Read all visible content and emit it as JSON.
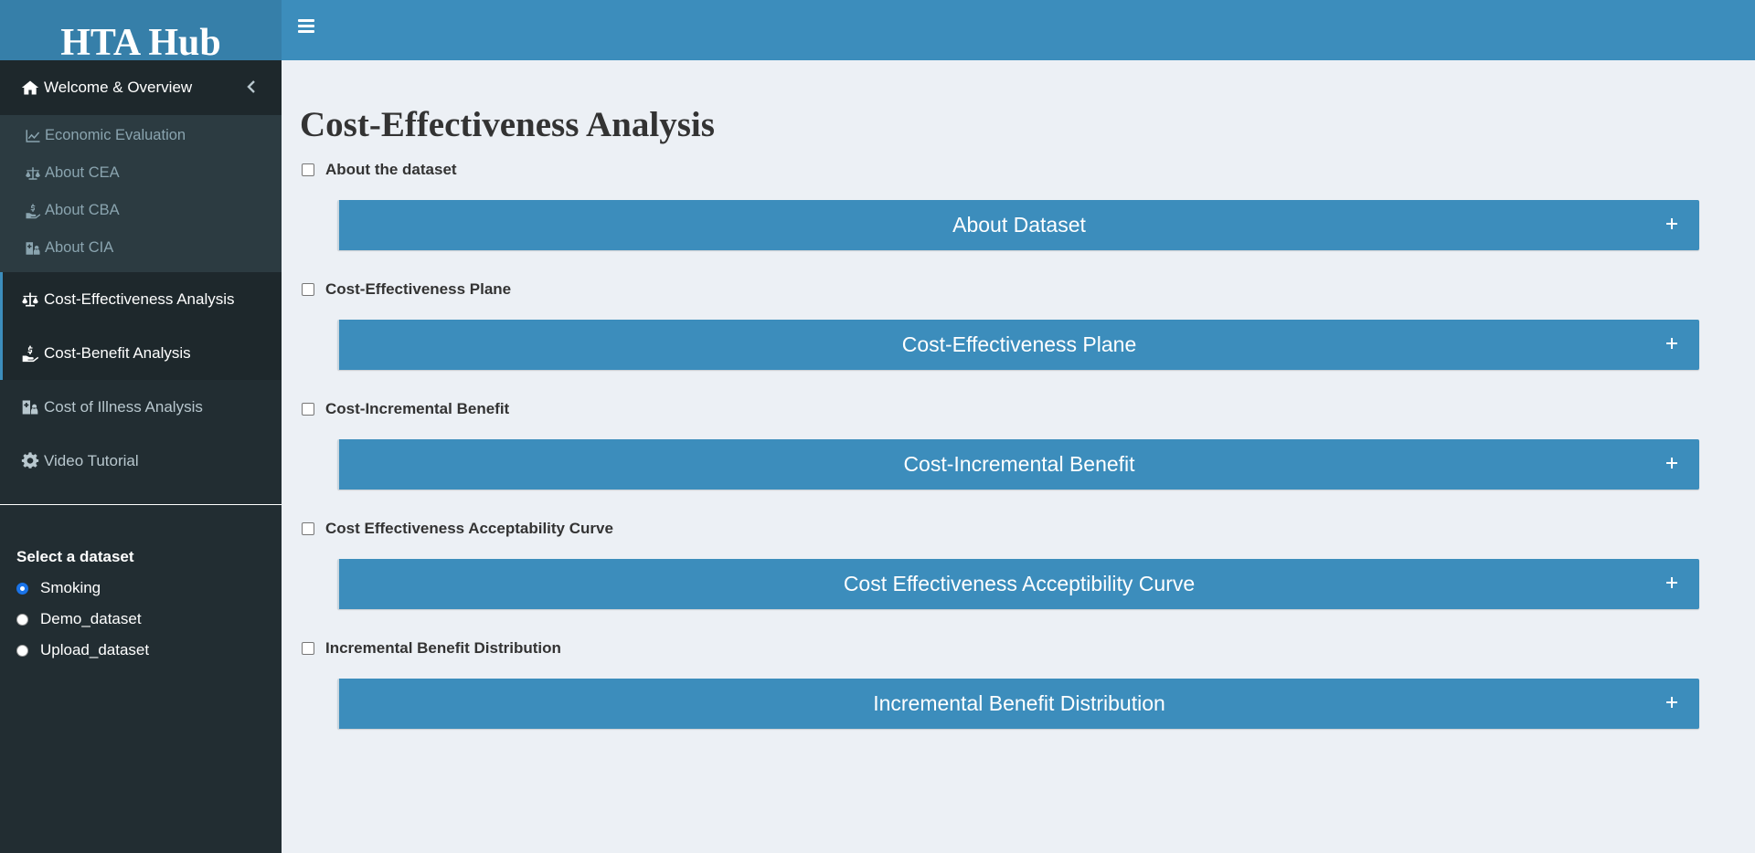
{
  "app": {
    "title": "HTA Hub"
  },
  "sidebar": {
    "items": [
      {
        "label": "Welcome & Overview",
        "icon": "home-icon"
      },
      {
        "label": "Cost-Effectiveness Analysis",
        "icon": "balance-scale-icon"
      },
      {
        "label": "Cost-Benefit Analysis",
        "icon": "hand-holding-dollar-icon"
      },
      {
        "label": "Cost of Illness Analysis",
        "icon": "hospital-user-icon"
      },
      {
        "label": "Video Tutorial",
        "icon": "gear-icon"
      }
    ],
    "subitems": [
      {
        "label": "Economic Evaluation",
        "icon": "line-chart-icon"
      },
      {
        "label": "About CEA",
        "icon": "balance-scale-icon"
      },
      {
        "label": "About CBA",
        "icon": "hand-holding-dollar-icon"
      },
      {
        "label": "About CIA",
        "icon": "hospital-user-icon"
      }
    ],
    "dataset_label": "Select a dataset",
    "datasets": [
      "Smoking",
      "Demo_dataset",
      "Upload_dataset"
    ],
    "selected_dataset": "Smoking"
  },
  "main": {
    "title": "Cost-Effectiveness Analysis",
    "sections": [
      {
        "checkbox_label": "About the dataset",
        "box_title": "About Dataset",
        "checked": false
      },
      {
        "checkbox_label": "Cost-Effectiveness Plane",
        "box_title": "Cost-Effectiveness Plane",
        "checked": false
      },
      {
        "checkbox_label": "Cost-Incremental Benefit",
        "box_title": "Cost-Incremental Benefit",
        "checked": false
      },
      {
        "checkbox_label": "Cost Effectiveness Acceptability Curve",
        "box_title": "Cost Effectiveness Acceptibility Curve",
        "checked": false
      },
      {
        "checkbox_label": "Incremental Benefit Distribution",
        "box_title": "Incremental Benefit Distribution",
        "checked": false
      }
    ]
  },
  "colors": {
    "primary": "#3c8dbc",
    "logo_bg": "#367fa9",
    "sidebar_bg": "#222d32",
    "content_bg": "#ecf0f5"
  }
}
